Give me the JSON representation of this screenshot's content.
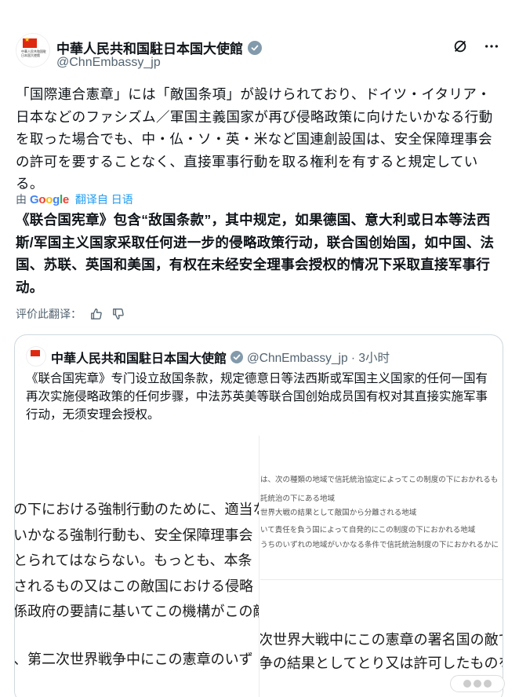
{
  "header": {
    "display_name": "中華人民共和国駐日本国大使館",
    "handle": "@ChnEmbassy_jp",
    "avatar_text": "中華人民共和国駐日本国大使館"
  },
  "post": {
    "jp_text": "「国際連合憲章」には「敵国条項」が設けられており、ドイツ・イタリア・日本などのファシズム／軍国主義国家が再び侵略政策に向けたいかなる行動を取った場合でも、中・仏・ソ・英・米など国連創設国は、安全保障理事会の許可を要することなく、直接軍事行動を取る権利を有すると規定している。",
    "translated_by_prefix": "由",
    "translated_by_brand": "Google",
    "translate_link": "翻译自 日语",
    "cn_text": "《联合国宪章》包含“敌国条款”，其中规定，如果德国、意大利或日本等法西斯/军国主义国家采取任何进一步的侵略政策行动，联合国创始国，如中国、法国、苏联、英国和美国，有权在未经安全理事会授权的情况下采取直接军事行动。",
    "rate_label": "评价此翻译："
  },
  "quote": {
    "display_name": "中華人民共和国駐日本国大使館",
    "handle_time": "@ChnEmbassy_jp · 3小时",
    "text": "《联合国宪章》专门设立敌国条款，规定德意日等法西斯或军国主义国家的任何一国有再次实施侵略政策的任何步骤，中法苏英美等联合国创始成员国有权对其直接实施军事行动，无须安理会授权。"
  },
  "media": {
    "left_lines": [
      "の下における強制行動のために、適当な",
      "いかなる強制行動も、安全保障理事会",
      "とられてはならない。もっとも、本条",
      "されるもの又はこの敵国における侵略",
      "係政府の要請に基いてこの機構がこの敵",
      "、第二次世界戦争中にこの憲章のいず"
    ],
    "right_small_lines": [
      "は、次の種類の地域で信託統治協定によってこの制度の下におかれるも",
      "託統治の下にある地域",
      "世界大戦の結果として敵国から分離される地域",
      "いて責任を負う国によって自発的にこの制度の下におかれる地域",
      "うちのいずれの地域がいかなる条件で信託統治制度の下におかれるかに"
    ],
    "right_big_lines": [
      "次世界大戦中にこの憲章の署名国の敵であ",
      "争の結果としてとり又は許可したものを無"
    ]
  },
  "icons": {
    "verified": "verified-badge-icon",
    "grok": "grok-icon",
    "more": "more-icon",
    "like": "thumbs-up-icon",
    "dislike": "thumbs-down-icon"
  },
  "colors": {
    "accent": "#1d9bf0",
    "muted": "#536471",
    "flag_red": "#de2910"
  }
}
